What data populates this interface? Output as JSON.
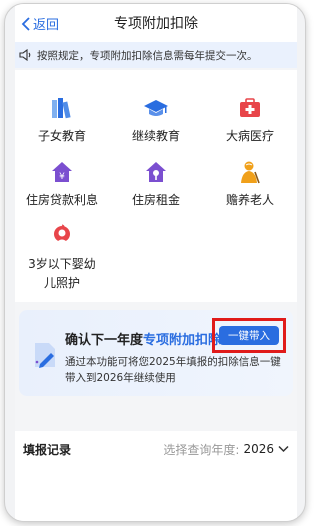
{
  "navbar": {
    "back_label": "返回",
    "title": "专项附加扣除"
  },
  "notice": {
    "text": "按照规定，专项附加扣除信息需每年提交一次。"
  },
  "categories": [
    {
      "label": "子女教育",
      "icon": "books-icon"
    },
    {
      "label": "继续教育",
      "icon": "graduation-cap-icon"
    },
    {
      "label": "大病医疗",
      "icon": "medical-kit-icon"
    },
    {
      "label": "住房贷款利息",
      "icon": "house-yen-icon"
    },
    {
      "label": "住房租金",
      "icon": "house-key-icon"
    },
    {
      "label": "赡养老人",
      "icon": "elder-icon"
    },
    {
      "label": "3岁以下婴幼儿照护",
      "icon": "infant-icon"
    }
  ],
  "banner": {
    "title_prefix": "确认下一年度",
    "title_highlight": "专项附加扣除",
    "button_label": "一键带入",
    "description": "通过本功能可将您2025年填报的扣除信息一键带入到2026年继续使用"
  },
  "records": {
    "heading": "填报记录",
    "year_query_label": "选择查询年度:",
    "year_value": "2026"
  },
  "colors": {
    "accent": "#2a6de0",
    "highlight_box": "#e01b1b",
    "icon_orange": "#f0a01a",
    "icon_purple": "#7b4fd0",
    "icon_red": "#e8454a"
  }
}
